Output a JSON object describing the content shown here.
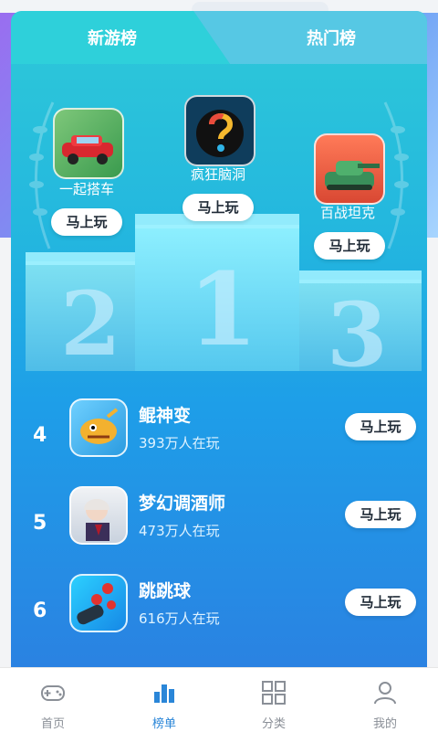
{
  "tabs": {
    "new_games": "新游榜",
    "hot": "热门榜"
  },
  "podium": [
    {
      "rank": "2",
      "name": "一起搭车",
      "button": "马上玩",
      "icon": "car-game-icon"
    },
    {
      "rank": "1",
      "name": "疯狂脑洞",
      "button": "马上玩",
      "icon": "brain-question-icon"
    },
    {
      "rank": "3",
      "name": "百战坦克",
      "button": "马上玩",
      "icon": "tank-game-icon"
    }
  ],
  "list": [
    {
      "rank": "4",
      "name": "鲲神变",
      "players": "393万人在玩",
      "button": "马上玩",
      "icon": "fish-monster-icon"
    },
    {
      "rank": "5",
      "name": "梦幻调酒师",
      "players": "473万人在玩",
      "button": "马上玩",
      "icon": "anime-character-icon"
    },
    {
      "rank": "6",
      "name": "跳跳球",
      "players": "616万人在玩",
      "button": "马上玩",
      "icon": "ball-game-icon"
    }
  ],
  "nav": [
    {
      "label": "首页",
      "icon": "gamepad-icon"
    },
    {
      "label": "榜单",
      "icon": "bar-chart-icon"
    },
    {
      "label": "分类",
      "icon": "grid-icon"
    },
    {
      "label": "我的",
      "icon": "user-icon"
    }
  ],
  "colors": {
    "accent": "#2a86d8",
    "panel_top": "#2ec9d8",
    "panel_bottom": "#2a82e2"
  }
}
